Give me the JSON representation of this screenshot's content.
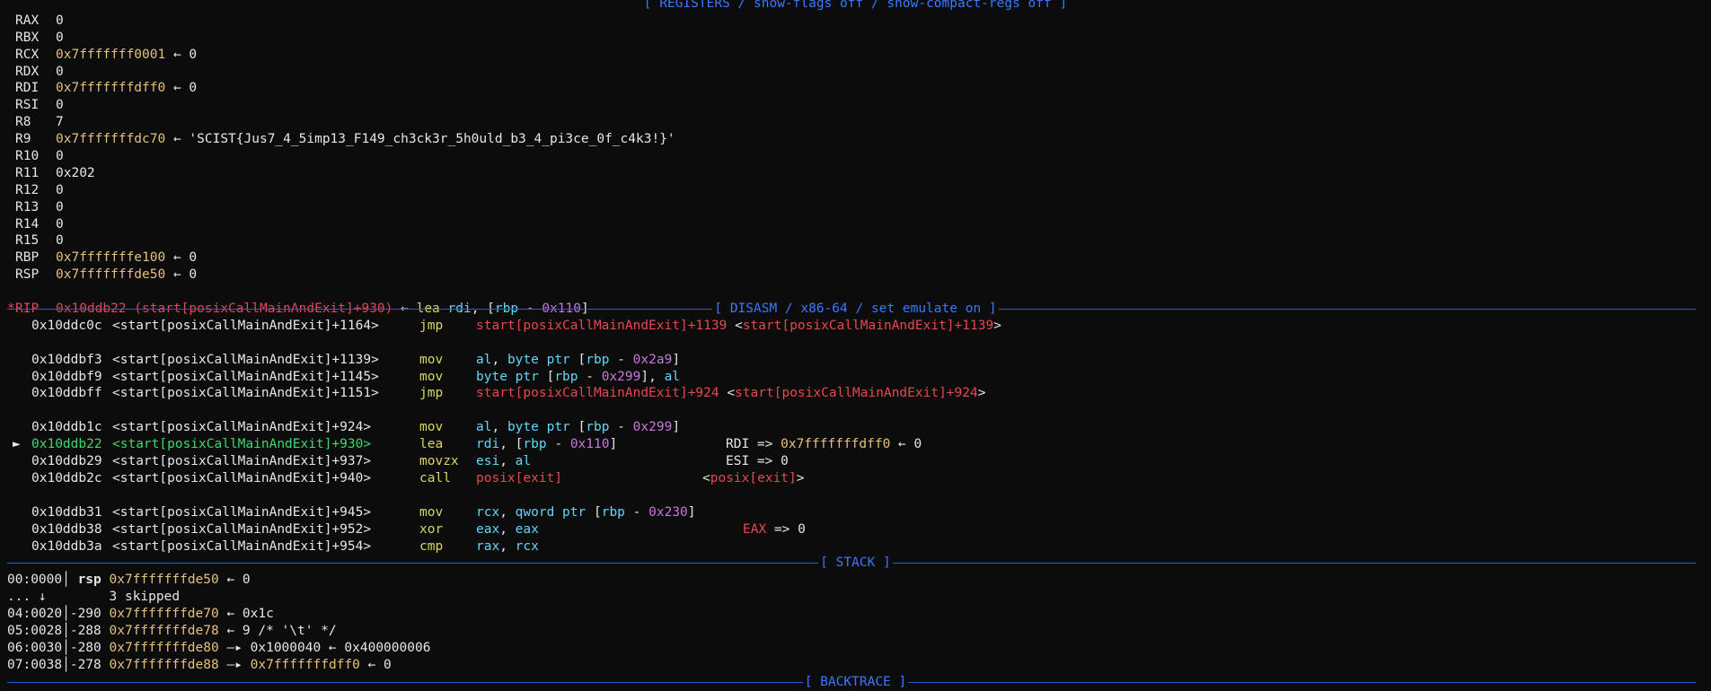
{
  "registers": {
    "header": "[ REGISTERS / show-flags off / show-compact-regs off ]",
    "rows": [
      {
        "name": "RAX",
        "value": "0",
        "deref": ""
      },
      {
        "name": "RBX",
        "value": "0",
        "deref": ""
      },
      {
        "name": "RCX",
        "value": "0x7fffffff0001",
        "deref": " ← 0"
      },
      {
        "name": "RDX",
        "value": "0",
        "deref": ""
      },
      {
        "name": "RDI",
        "value": "0x7fffffffdff0",
        "deref": " ← 0"
      },
      {
        "name": "RSI",
        "value": "0",
        "deref": ""
      },
      {
        "name": "R8",
        "value": "7",
        "deref": ""
      },
      {
        "name": "R9",
        "value": "0x7fffffffdc70",
        "deref": " ← 'SCIST{Jus7_4_5imp13_F149_ch3ck3r_5h0uld_b3_4_pi3ce_0f_c4k3!}'"
      },
      {
        "name": "R10",
        "value": "0",
        "deref": ""
      },
      {
        "name": "R11",
        "value": "0x202",
        "deref": ""
      },
      {
        "name": "R12",
        "value": "0",
        "deref": ""
      },
      {
        "name": "R13",
        "value": "0",
        "deref": ""
      },
      {
        "name": "R14",
        "value": "0",
        "deref": ""
      },
      {
        "name": "R15",
        "value": "0",
        "deref": ""
      },
      {
        "name": "RBP",
        "value": "0x7fffffffe100",
        "deref": " ← 0"
      },
      {
        "name": "RSP",
        "value": "0x7fffffffde50",
        "deref": " ← 0"
      }
    ],
    "rip": {
      "marker": "*",
      "name": "RIP",
      "value": "0x10ddb22 (start[posixCallMainAndExit]+930)",
      "arrow": " ← ",
      "mnemonic": "lea",
      "op1": " rdi",
      "op_rest": ", [",
      "base": "rbp",
      "minus": " - ",
      "offset": "0x110",
      "close": "]"
    }
  },
  "disasm": {
    "header": "[ DISASM / x86-64 / set emulate on ]",
    "groups": [
      [
        {
          "current": false,
          "addr": "0x10ddc0c",
          "sym": "<start[posixCallMainAndExit]+1164>",
          "mn": "jmp",
          "ops": [
            [
              "red",
              "start[posixCallMainAndExit]+1139"
            ],
            [
              "wht",
              " <"
            ],
            [
              "red",
              "start[posixCallMainAndExit]+1139"
            ],
            [
              "wht",
              ">"
            ]
          ],
          "note": []
        }
      ],
      [
        {
          "current": false,
          "addr": "0x10ddbf3",
          "sym": "<start[posixCallMainAndExit]+1139>",
          "mn": "mov",
          "ops": [
            [
              "cyan",
              "al"
            ],
            [
              "wht",
              ", "
            ],
            [
              "cyan",
              "byte ptr"
            ],
            [
              "wht",
              " ["
            ],
            [
              "cyan",
              "rbp"
            ],
            [
              "wht",
              " - "
            ],
            [
              "mag",
              "0x2a9"
            ],
            [
              "wht",
              "]"
            ]
          ],
          "note": []
        },
        {
          "current": false,
          "addr": "0x10ddbf9",
          "sym": "<start[posixCallMainAndExit]+1145>",
          "mn": "mov",
          "ops": [
            [
              "cyan",
              "byte ptr"
            ],
            [
              "wht",
              " ["
            ],
            [
              "cyan",
              "rbp"
            ],
            [
              "wht",
              " - "
            ],
            [
              "mag",
              "0x299"
            ],
            [
              "wht",
              "], "
            ],
            [
              "cyan",
              "al"
            ]
          ],
          "note": []
        },
        {
          "current": false,
          "addr": "0x10ddbff",
          "sym": "<start[posixCallMainAndExit]+1151>",
          "mn": "jmp",
          "ops": [
            [
              "red",
              "start[posixCallMainAndExit]+924"
            ],
            [
              "wht",
              " <"
            ],
            [
              "red",
              "start[posixCallMainAndExit]+924"
            ],
            [
              "wht",
              ">"
            ]
          ],
          "note": []
        }
      ],
      [
        {
          "current": false,
          "addr": "0x10ddb1c",
          "sym": "<start[posixCallMainAndExit]+924>",
          "mn": "mov",
          "ops": [
            [
              "cyan",
              "al"
            ],
            [
              "wht",
              ", "
            ],
            [
              "cyan",
              "byte ptr"
            ],
            [
              "wht",
              " ["
            ],
            [
              "cyan",
              "rbp"
            ],
            [
              "wht",
              " - "
            ],
            [
              "mag",
              "0x299"
            ],
            [
              "wht",
              "]"
            ]
          ],
          "note": []
        },
        {
          "current": true,
          "marker": "►",
          "addr": "0x10ddb22",
          "sym": "<start[posixCallMainAndExit]+930>",
          "mn": "lea",
          "ops": [
            [
              "cyan",
              "rdi"
            ],
            [
              "wht",
              ", ["
            ],
            [
              "cyan",
              "rbp"
            ],
            [
              "wht",
              " - "
            ],
            [
              "mag",
              "0x110"
            ],
            [
              "wht",
              "]"
            ]
          ],
          "note": [
            [
              "wht",
              "RDI => "
            ],
            [
              "yel",
              "0x7fffffffdff0"
            ],
            [
              "wht",
              " ← 0"
            ]
          ],
          "note_col": 808
        },
        {
          "current": false,
          "addr": "0x10ddb29",
          "sym": "<start[posixCallMainAndExit]+937>",
          "mn": "movzx",
          "ops": [
            [
              "cyan",
              "esi"
            ],
            [
              "wht",
              ", "
            ],
            [
              "cyan",
              "al"
            ]
          ],
          "note": [
            [
              "wht",
              "ESI => 0"
            ]
          ],
          "note_col": 808
        },
        {
          "current": false,
          "addr": "0x10ddb2c",
          "sym": "<start[posixCallMainAndExit]+940>",
          "mn": "call",
          "ops": [
            [
              "red",
              "posix[exit]"
            ]
          ],
          "note": [
            [
              "wht",
              "<"
            ],
            [
              "red",
              "posix[exit]"
            ],
            [
              "wht",
              ">"
            ]
          ],
          "note_col": 782
        }
      ],
      [
        {
          "current": false,
          "addr": "0x10ddb31",
          "sym": "<start[posixCallMainAndExit]+945>",
          "mn": "mov",
          "ops": [
            [
              "cyan",
              "rcx"
            ],
            [
              "wht",
              ", "
            ],
            [
              "cyan",
              "qword ptr"
            ],
            [
              "wht",
              " ["
            ],
            [
              "cyan",
              "rbp"
            ],
            [
              "wht",
              " - "
            ],
            [
              "mag",
              "0x230"
            ],
            [
              "wht",
              "]"
            ]
          ],
          "note": []
        },
        {
          "current": false,
          "addr": "0x10ddb38",
          "sym": "<start[posixCallMainAndExit]+952>",
          "mn": "xor",
          "ops": [
            [
              "cyan",
              "eax"
            ],
            [
              "wht",
              ", "
            ],
            [
              "cyan",
              "eax"
            ]
          ],
          "note": [
            [
              "red",
              "EAX"
            ],
            [
              "wht",
              " => 0"
            ]
          ],
          "note_col": 827
        },
        {
          "current": false,
          "addr": "0x10ddb3a",
          "sym": "<start[posixCallMainAndExit]+954>",
          "mn": "cmp",
          "ops": [
            [
              "cyan",
              "rax"
            ],
            [
              "wht",
              ", "
            ],
            [
              "cyan",
              "rcx"
            ]
          ],
          "note": []
        }
      ]
    ]
  },
  "stack": {
    "header": "[ STACK ]",
    "rows": [
      [
        [
          "wht",
          "00:0000"
        ],
        [
          "wht",
          "│ "
        ],
        [
          "bold",
          "rsp"
        ],
        [
          "wht",
          " "
        ],
        [
          "yel",
          "0x7fffffffde50"
        ],
        [
          "wht",
          " ← 0"
        ]
      ],
      [
        [
          "wht",
          "... ↓        "
        ],
        [
          "wht",
          "3 skipped"
        ]
      ],
      [
        [
          "wht",
          "04:0020"
        ],
        [
          "wht",
          "│-290 "
        ],
        [
          "yel",
          "0x7fffffffde70"
        ],
        [
          "wht",
          " ← 0x1c"
        ]
      ],
      [
        [
          "wht",
          "05:0028"
        ],
        [
          "wht",
          "│-288 "
        ],
        [
          "yel",
          "0x7fffffffde78"
        ],
        [
          "wht",
          " ← 9 /* '\\t' */"
        ]
      ],
      [
        [
          "wht",
          "06:0030"
        ],
        [
          "wht",
          "│-280 "
        ],
        [
          "yel",
          "0x7fffffffde80"
        ],
        [
          "wht",
          " —▸ 0x1000040 ← 0x400000006"
        ]
      ],
      [
        [
          "wht",
          "07:0038"
        ],
        [
          "wht",
          "│-278 "
        ],
        [
          "yel",
          "0x7fffffffde88"
        ],
        [
          "wht",
          " —▸ "
        ],
        [
          "yel",
          "0x7fffffffdff0"
        ],
        [
          "wht",
          " ← 0"
        ]
      ]
    ]
  },
  "backtrace": {
    "header": "[ BACKTRACE ]"
  }
}
